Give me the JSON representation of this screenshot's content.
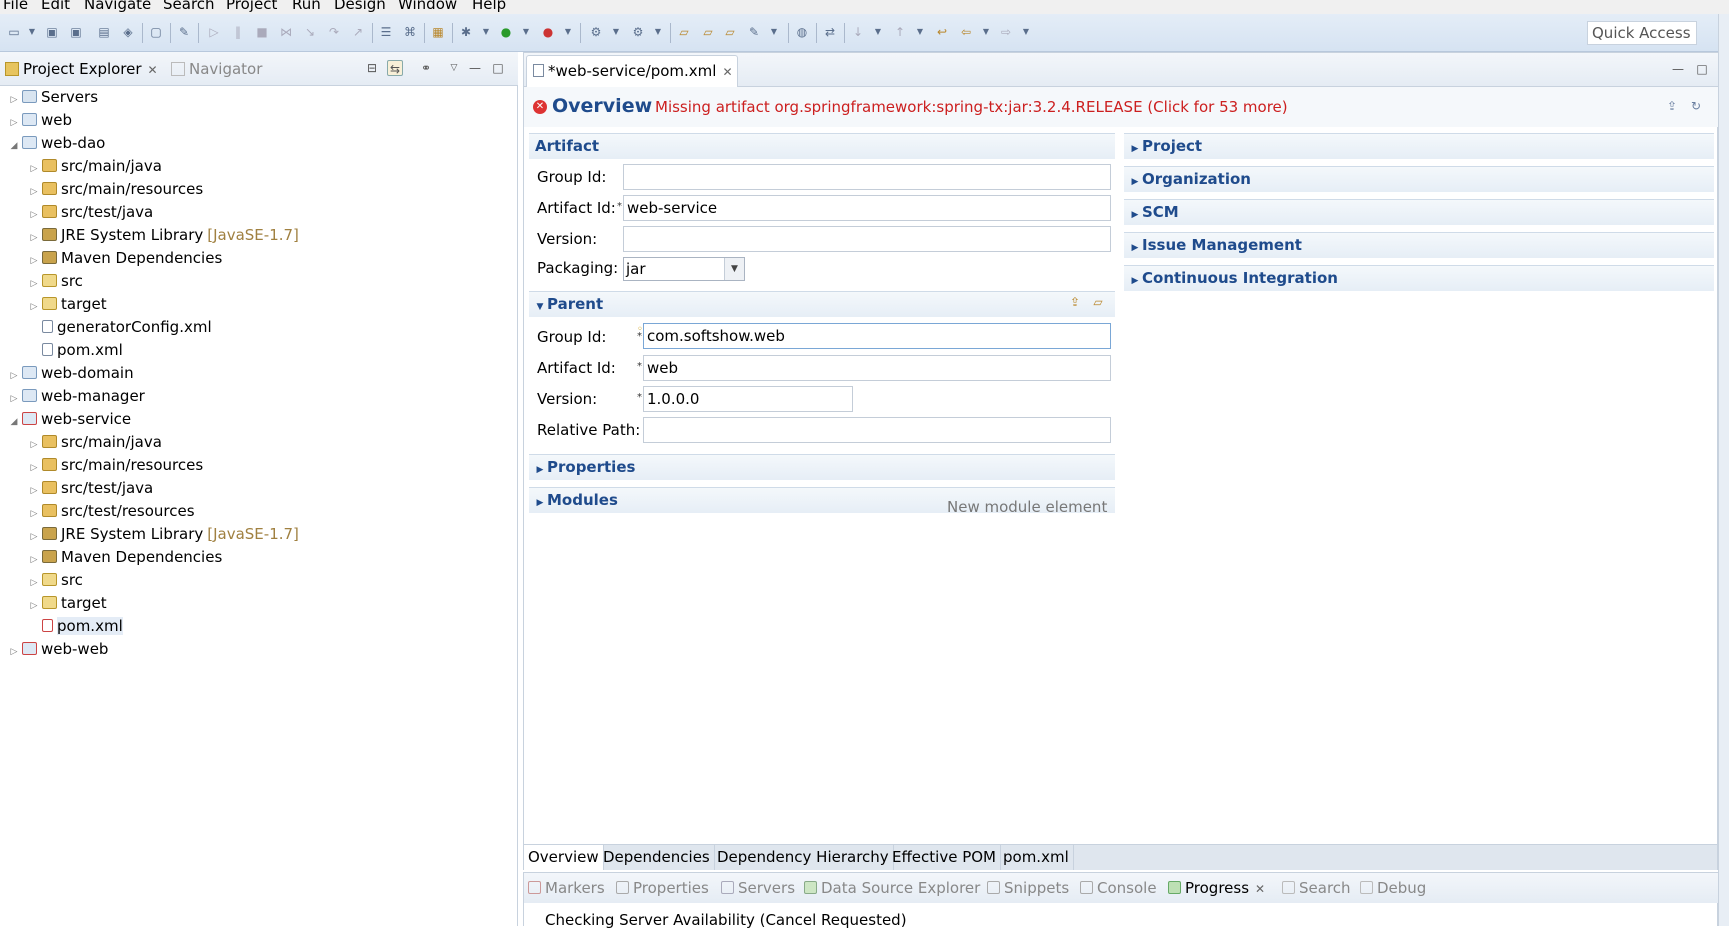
{
  "menu": [
    "File",
    "Edit",
    "Navigate",
    "Search",
    "Project",
    "Run",
    "Design",
    "Window",
    "Help"
  ],
  "toolbar": {
    "quick_access": "Quick Access"
  },
  "left_tabs": {
    "project_explorer": "Project Explorer",
    "navigator": "Navigator"
  },
  "tree": [
    {
      "label": "Servers",
      "deco": ""
    },
    {
      "label": "web",
      "deco": ""
    },
    {
      "label": "web-dao",
      "deco": ""
    },
    {
      "label": "src/main/java",
      "deco": ""
    },
    {
      "label": "src/main/resources",
      "deco": ""
    },
    {
      "label": "src/test/java",
      "deco": ""
    },
    {
      "label": "JRE System Library",
      "deco": "[JavaSE-1.7]"
    },
    {
      "label": "Maven Dependencies",
      "deco": ""
    },
    {
      "label": "src",
      "deco": ""
    },
    {
      "label": "target",
      "deco": ""
    },
    {
      "label": "generatorConfig.xml",
      "deco": ""
    },
    {
      "label": "pom.xml",
      "deco": ""
    },
    {
      "label": "web-domain",
      "deco": ""
    },
    {
      "label": "web-manager",
      "deco": ""
    },
    {
      "label": "web-service",
      "deco": ""
    },
    {
      "label": "src/main/java",
      "deco": ""
    },
    {
      "label": "src/main/resources",
      "deco": ""
    },
    {
      "label": "src/test/java",
      "deco": ""
    },
    {
      "label": "src/test/resources",
      "deco": ""
    },
    {
      "label": "JRE System Library",
      "deco": "[JavaSE-1.7]"
    },
    {
      "label": "Maven Dependencies",
      "deco": ""
    },
    {
      "label": "src",
      "deco": ""
    },
    {
      "label": "target",
      "deco": ""
    },
    {
      "label": "pom.xml",
      "deco": ""
    },
    {
      "label": "web-web",
      "deco": ""
    }
  ],
  "editor": {
    "tab_title": "*web-service/pom.xml",
    "overview_title": "Overview",
    "error_message": "Missing artifact org.springframework:spring-tx:jar:3.2.4.RELEASE (Click for 53 more)",
    "artifact": {
      "heading": "Artifact",
      "group_id_label": "Group Id:",
      "group_id_value": "",
      "artifact_id_label": "Artifact Id:",
      "artifact_id_value": "web-service",
      "version_label": "Version:",
      "version_value": "",
      "packaging_label": "Packaging:",
      "packaging_value": "jar"
    },
    "parent": {
      "heading": "Parent",
      "group_id_label": "Group Id:",
      "group_id_value": "com.softshow.web",
      "artifact_id_label": "Artifact Id:",
      "artifact_id_value": "web",
      "version_label": "Version:",
      "version_value": "1.0.0.0",
      "relative_path_label": "Relative Path:",
      "relative_path_value": ""
    },
    "properties_heading": "Properties",
    "modules_heading": "Modules",
    "new_module": "New module element",
    "right_sections": [
      "Project",
      "Organization",
      "SCM",
      "Issue Management",
      "Continuous Integration"
    ],
    "page_tabs": [
      "Overview",
      "Dependencies",
      "Dependency Hierarchy",
      "Effective POM",
      "pom.xml"
    ]
  },
  "bottom": {
    "tabs": [
      "Markers",
      "Properties",
      "Servers",
      "Data Source Explorer",
      "Snippets",
      "Console",
      "Progress",
      "Search",
      "Debug"
    ],
    "status": "Checking Server Availability (Cancel Requested)"
  }
}
